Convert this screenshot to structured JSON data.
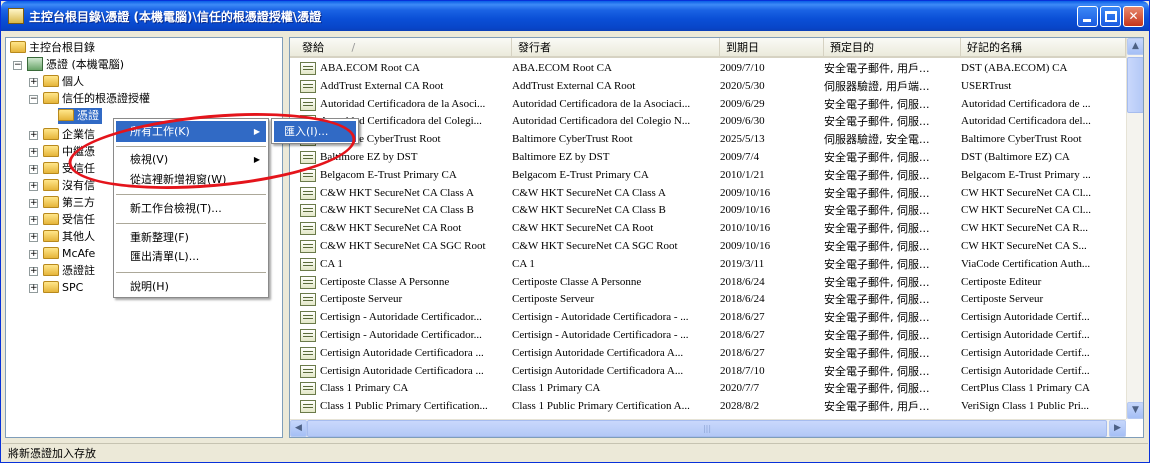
{
  "window": {
    "title": "主控台根目錄\\憑證 (本機電腦)\\信任的根憑證授權\\憑證"
  },
  "tree": {
    "items": [
      {
        "label": "主控台根目錄"
      },
      {
        "label": "憑證 (本機電腦)"
      },
      {
        "label": "個人"
      },
      {
        "label": "信任的根憑證授權"
      },
      {
        "label": "憑證"
      },
      {
        "label": "企業信"
      },
      {
        "label": "中繼憑"
      },
      {
        "label": "受信任"
      },
      {
        "label": "沒有信"
      },
      {
        "label": "第三方"
      },
      {
        "label": "受信任"
      },
      {
        "label": "其他人"
      },
      {
        "label": "McAfe"
      },
      {
        "label": "憑證註"
      },
      {
        "label": "SPC"
      }
    ]
  },
  "context_menu": {
    "items": [
      {
        "label": "所有工作(K)",
        "submenu": true,
        "selected": true
      },
      {
        "label": "檢視(V)",
        "submenu": true
      },
      {
        "label": "從這裡新增視窗(W)"
      },
      {
        "label": "新工作台檢視(T)..."
      },
      {
        "label": "重新整理(F)"
      },
      {
        "label": "匯出清單(L)..."
      },
      {
        "label": "說明(H)"
      }
    ],
    "submenu": {
      "items": [
        {
          "label": "匯入(I)...",
          "selected": true
        }
      ]
    }
  },
  "list": {
    "columns": [
      "發給",
      "發行者",
      "到期日",
      "預定目的",
      "好記的名稱"
    ],
    "sort_indicator": "/",
    "rows": [
      [
        "ABA.ECOM Root CA",
        "ABA.ECOM Root CA",
        "2009/7/10",
        "安全電子郵件, 用戶...",
        "DST (ABA.ECOM) CA"
      ],
      [
        "AddTrust External CA Root",
        "AddTrust External CA Root",
        "2020/5/30",
        "伺服器驗證, 用戶端...",
        "USERTrust"
      ],
      [
        "Autoridad Certificadora de la Asoci...",
        "Autoridad Certificadora de la Asociaci...",
        "2009/6/29",
        "安全電子郵件, 伺服...",
        "Autoridad Certificadora de ..."
      ],
      [
        "Autoridad Certificadora del Colegi...",
        "Autoridad Certificadora del Colegio N...",
        "2009/6/30",
        "安全電子郵件, 伺服...",
        "Autoridad Certificadora del..."
      ],
      [
        "Baltimore CyberTrust Root",
        "Baltimore CyberTrust Root",
        "2025/5/13",
        "伺服器驗證, 安全電...",
        "Baltimore CyberTrust Root"
      ],
      [
        "Baltimore EZ by DST",
        "Baltimore EZ by DST",
        "2009/7/4",
        "安全電子郵件, 伺服...",
        "DST (Baltimore EZ) CA"
      ],
      [
        "Belgacom E-Trust Primary CA",
        "Belgacom E-Trust Primary CA",
        "2010/1/21",
        "安全電子郵件, 伺服...",
        "Belgacom E-Trust Primary ..."
      ],
      [
        "C&W HKT SecureNet CA Class A",
        "C&W HKT SecureNet CA Class A",
        "2009/10/16",
        "安全電子郵件, 伺服...",
        "CW HKT SecureNet CA Cl..."
      ],
      [
        "C&W HKT SecureNet CA Class B",
        "C&W HKT SecureNet CA Class B",
        "2009/10/16",
        "安全電子郵件, 伺服...",
        "CW HKT SecureNet CA Cl..."
      ],
      [
        "C&W HKT SecureNet CA Root",
        "C&W HKT SecureNet CA Root",
        "2010/10/16",
        "安全電子郵件, 伺服...",
        "CW HKT SecureNet CA R..."
      ],
      [
        "C&W HKT SecureNet CA SGC Root",
        "C&W HKT SecureNet CA SGC Root",
        "2009/10/16",
        "安全電子郵件, 伺服...",
        "CW HKT SecureNet CA S..."
      ],
      [
        "CA 1",
        "CA 1",
        "2019/3/11",
        "安全電子郵件, 伺服...",
        "ViaCode Certification Auth..."
      ],
      [
        "Certiposte Classe A Personne",
        "Certiposte Classe A Personne",
        "2018/6/24",
        "安全電子郵件, 伺服...",
        "Certiposte Editeur"
      ],
      [
        "Certiposte Serveur",
        "Certiposte Serveur",
        "2018/6/24",
        "安全電子郵件, 伺服...",
        "Certiposte Serveur"
      ],
      [
        "Certisign - Autoridade Certificador...",
        "Certisign - Autoridade Certificadora - ...",
        "2018/6/27",
        "安全電子郵件, 伺服...",
        "Certisign Autoridade Certif..."
      ],
      [
        "Certisign - Autoridade Certificador...",
        "Certisign - Autoridade Certificadora - ...",
        "2018/6/27",
        "安全電子郵件, 伺服...",
        "Certisign Autoridade Certif..."
      ],
      [
        "Certisign Autoridade Certificadora ...",
        "Certisign Autoridade Certificadora A...",
        "2018/6/27",
        "安全電子郵件, 伺服...",
        "Certisign Autoridade Certif..."
      ],
      [
        "Certisign Autoridade Certificadora ...",
        "Certisign Autoridade Certificadora A...",
        "2018/7/10",
        "安全電子郵件, 伺服...",
        "Certisign Autoridade Certif..."
      ],
      [
        "Class 1 Primary CA",
        "Class 1 Primary CA",
        "2020/7/7",
        "安全電子郵件, 伺服...",
        "CertPlus Class 1 Primary CA"
      ],
      [
        "Class 1 Public Primary Certification...",
        "Class 1 Public Primary Certification A...",
        "2028/8/2",
        "安全電子郵件, 用戶...",
        "VeriSign Class 1 Public Pri..."
      ]
    ]
  },
  "statusbar": {
    "text": "將新憑證加入存放"
  },
  "annotation": {
    "color": "#e4141b"
  }
}
